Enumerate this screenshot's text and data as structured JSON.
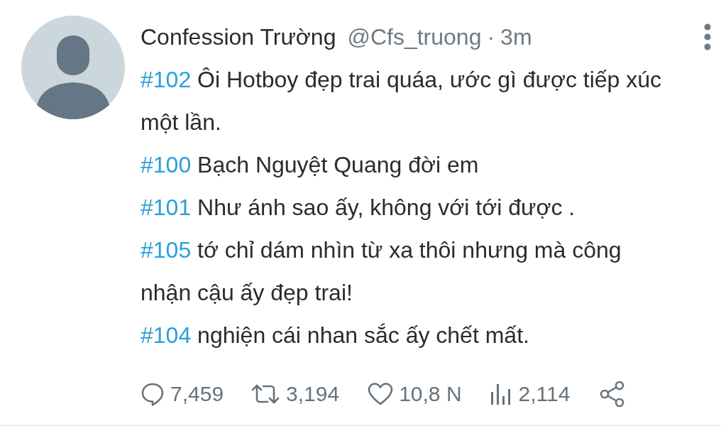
{
  "tweet": {
    "author_name": "Confession Trường",
    "handle": "@Cfs_truong",
    "separator": "·",
    "time": "3m",
    "entries": [
      {
        "tag": "#102",
        "text": "Ôi Hotboy đẹp trai quáa, ước gì được tiếp xúc một lần."
      },
      {
        "tag": "#100",
        "text": "Bạch Nguyệt Quang đời em"
      },
      {
        "tag": "#101",
        "text": "Như ánh sao ấy, không với tới được ."
      },
      {
        "tag": "#105",
        "text": "tớ chỉ dám nhìn từ xa thôi nhưng mà công nhận cậu ấy đẹp trai!"
      },
      {
        "tag": "#104",
        "text": "nghiện cái nhan sắc ấy chết mất."
      }
    ],
    "actions": [
      {
        "kind": "reply",
        "count": "7,459"
      },
      {
        "kind": "retweet",
        "count": "3,194"
      },
      {
        "kind": "like",
        "count": "10,8 N"
      },
      {
        "kind": "views",
        "count": "2,114"
      },
      {
        "kind": "share"
      }
    ]
  }
}
